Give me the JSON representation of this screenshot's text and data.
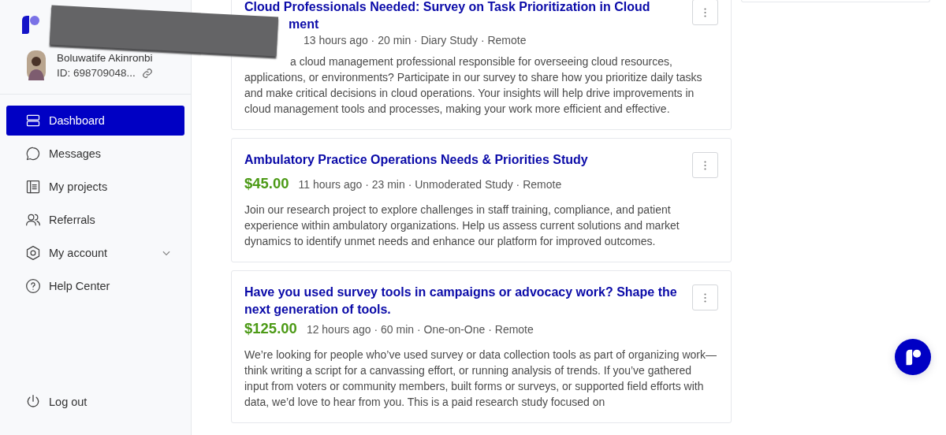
{
  "sidebar": {
    "user": {
      "name": "Boluwatife Akinronbi",
      "id": "ID: 698709048..."
    },
    "nav": [
      {
        "label": "Dashboard",
        "selected": true
      },
      {
        "label": "Messages",
        "selected": false
      },
      {
        "label": "My projects",
        "selected": false
      },
      {
        "label": "Referrals",
        "selected": false
      },
      {
        "label": "My account",
        "selected": false,
        "expandable": true
      },
      {
        "label": "Help Center",
        "selected": false
      }
    ],
    "logout": {
      "label": "Log out"
    }
  },
  "studies": [
    {
      "kind": "partial",
      "title_lines": [
        "Cloud Professionals Needed: Survey on Task Prioritization in Cloud",
        "ment"
      ],
      "meta": "13 hours ago · 20 min · Diary Study · Remote",
      "description": "a cloud management professional responsible for overseeing cloud resources, applications, or environments? Participate in our survey to share how you prioritize daily tasks and make critical decisions in cloud operations. Your insights will help drive improvements in cloud management tools and processes, making your work more efficient and effective."
    },
    {
      "kind": "full",
      "title": "Ambulatory Practice Operations Needs & Priorities Study",
      "price": "$45.00",
      "meta": "11 hours ago · 23 min · Unmoderated Study · Remote",
      "description": "Join our research project to explore challenges in staff training, compliance, and patient experience within ambulatory organizations. Help us assess current solutions and market dynamics to identify unmet needs and enhance our platform for improved outcomes."
    },
    {
      "kind": "full",
      "title": "Have you used survey tools in campaigns or advocacy work? Shape the next generation of tools.",
      "price": "$125.00",
      "meta": "12 hours ago · 60 min · One-on-One · Remote",
      "description": "We’re looking for people who’ve used survey or data collection tools as part of organizing work—think writing a script for a canvassing effort, or running analysis of trends. If you’ve gathered input from voters or community members, built forms or surveys, or supported field efforts with data, we’d love to hear from you. This is a paid research study focused on"
    }
  ]
}
